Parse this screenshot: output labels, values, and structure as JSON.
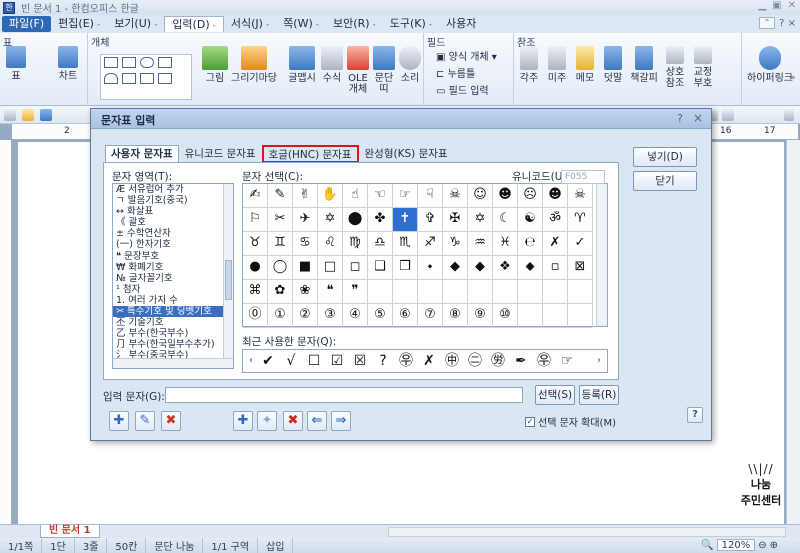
{
  "window": {
    "title": "빈 문서 1 - 한컴오피스 한글"
  },
  "menu": {
    "items": [
      {
        "label": "파일(F)",
        "arrow": "-"
      },
      {
        "label": "편집(E)",
        "arrow": "-"
      },
      {
        "label": "보기(U)",
        "arrow": "-"
      },
      {
        "label": "입력(D)",
        "arrow": "-"
      },
      {
        "label": "서식(J)",
        "arrow": "-"
      },
      {
        "label": "쪽(W)",
        "arrow": "-"
      },
      {
        "label": "보안(R)",
        "arrow": "-"
      },
      {
        "label": "도구(K)",
        "arrow": "-"
      },
      {
        "label": "사용자",
        "arrow": ""
      }
    ],
    "help": "? ×"
  },
  "ribbon": {
    "groups": {
      "table": "표",
      "object": "개체",
      "field": "필드",
      "reference": "참조"
    },
    "buttons": {
      "table": "표",
      "chart": "차트",
      "picture": "그림",
      "picture_market": "그리기마당",
      "glyph": "글맵시",
      "formula": "수식",
      "ole": "OLE\n개체",
      "paragraph": "문단\n띠",
      "sound": "소리",
      "form_object": "양식 개체",
      "press_field": "누름틀",
      "field_input": "필드 입력",
      "footnote": "각주",
      "endnote": "미주",
      "memo": "메모",
      "annotation": "덧말",
      "bookmark": "책갈피",
      "cross_ref": "상호\n참조",
      "proofread": "교정\n부호",
      "hyperlink": "하이퍼링크"
    }
  },
  "dialog": {
    "title": "문자표 입력",
    "help": "?",
    "close": "×",
    "tabs": [
      "사용자 문자표",
      "유니코드 문자표",
      "호글(HNC) 문자표",
      "완성형(KS) 문자표"
    ],
    "area_label": "문자 영역(T):",
    "char_label": "문자 선택(C):",
    "unicode_label": "유니코드(U):",
    "unicode_value": "F055",
    "area_items": [
      "Æ 서유럽어 추가",
      "ㄱ 발음기호(중국)",
      "↔ 화살표",
      "《 괄호",
      "± 수학연산자",
      "(一) 한자기호",
      "❝ 문장부호",
      "₩ 화폐기호",
      "№ 글자꼴기호",
      "¹ 첨자",
      "1. 여러 가지 수",
      "✂ 특수기호 및 딩벳기호",
      "丕 기술기호",
      "乙 부수(한국부수)",
      "⺆ 부수(한국일부수추가)",
      "⺡ 부수(중국부수)"
    ],
    "selected_area_index": 11,
    "char_rows": [
      [
        "✍",
        "✎",
        "✌",
        "✋",
        "☝",
        "☜",
        "☞",
        "☟",
        "☠",
        "☺",
        "☻",
        "☹",
        "☻",
        "☠"
      ],
      [
        "⚐",
        "✂",
        "✈",
        "✡",
        "⬤",
        "✤",
        "✝",
        "✞",
        "✠",
        "✡",
        "☾",
        "☯",
        "ॐ",
        "♈"
      ],
      [
        "♉",
        "♊",
        "♋",
        "♌",
        "♍",
        "♎",
        "♏",
        "♐",
        "♑",
        "♒",
        "♓",
        "℮",
        "✗",
        "✓"
      ],
      [
        "●",
        "◯",
        "■",
        "□",
        "◻",
        "❑",
        "❒",
        "⬩",
        "◆",
        "◆",
        "❖",
        "⬥",
        "▫",
        "⊠"
      ],
      [
        "⌘",
        "✿",
        "❀",
        "❝",
        "❞",
        "",
        "",
        "",
        "",
        "",
        "",
        "",
        "",
        ""
      ],
      [
        "⓪",
        "①",
        "②",
        "③",
        "④",
        "⑤",
        "⑥",
        "⑦",
        "⑧",
        "⑨",
        "⑩",
        "",
        "",
        ""
      ]
    ],
    "selected_char": [
      1,
      6
    ],
    "recent_label": "최근 사용한 문자(Q):",
    "recent_chars": [
      "✔",
      "√",
      "☐",
      "☑",
      "☒",
      "?",
      "㉾",
      "✗",
      "㊥",
      "㊁",
      "㊘",
      "✒",
      "㉾",
      "☞"
    ],
    "buttons": {
      "insert": "넣기(D)",
      "close": "닫기",
      "select": "선택(S)",
      "register": "등록(R)"
    },
    "input_label": "입력 문자(G):",
    "input_value": "",
    "enlarge_label": "선택 문자 확대(M)",
    "enlarge_checked": true,
    "icon_buttons": [
      "✚",
      "✦",
      "✖",
      "⇐",
      "⇒"
    ]
  },
  "doc": {
    "tab": "빈 문서 1",
    "ruler_marks": [
      "2",
      "16",
      "17"
    ]
  },
  "status": {
    "page": "1/1쪽",
    "section": "1단",
    "line": "3줄",
    "column": "50칸",
    "split": "문단 나눔",
    "area": "1/1 구역",
    "mode": "삽입",
    "zoom": "120%"
  },
  "watermark": {
    "line1": "나눔",
    "line2": "주민센터"
  },
  "colors": {
    "accent": "#2e69b5",
    "highlight_red": "#e0141a",
    "selection": "#2f6fd0"
  }
}
